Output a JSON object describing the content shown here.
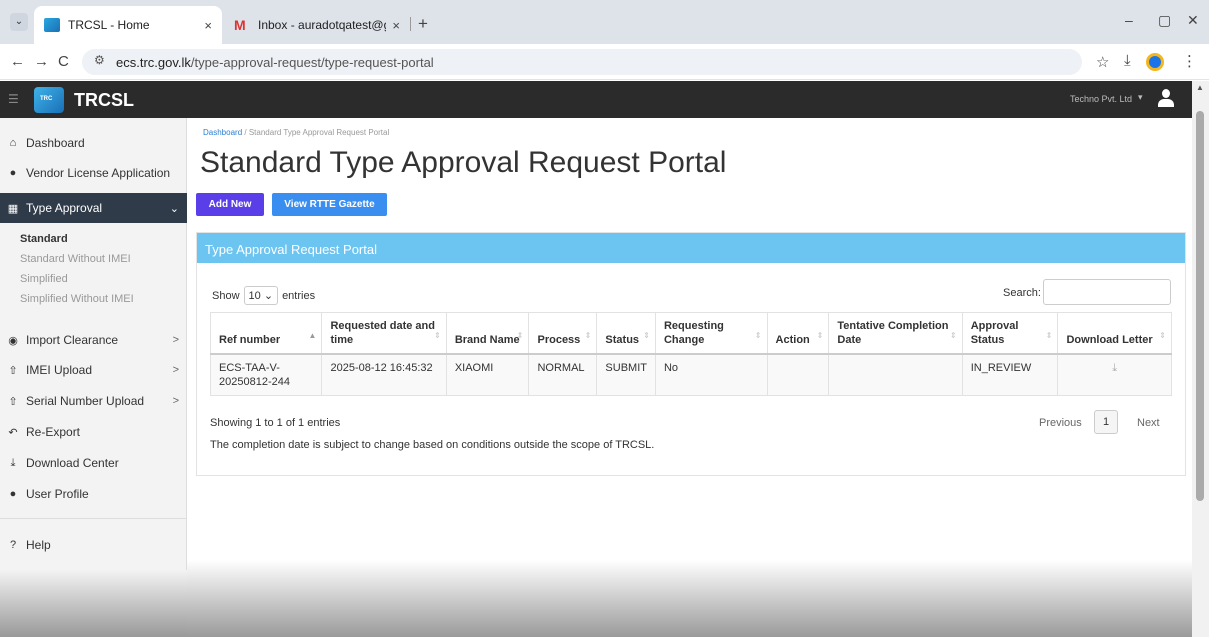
{
  "browser": {
    "tabs": [
      {
        "title": "TRCSL - Home",
        "close": "×"
      },
      {
        "title": "Inbox - auradotqatest@gmail.c",
        "close": "×"
      }
    ],
    "tab_menu": "⌄",
    "new_tab": "+",
    "window": {
      "minimize": "–",
      "restore": "▢",
      "close": "✕"
    },
    "nav": {
      "back": "←",
      "forward": "→",
      "reload": "C"
    },
    "url_host": "ecs.trc.gov.lk",
    "url_path": "/type-approval-request/type-request-portal",
    "star": "☆",
    "download": "⤓",
    "menu": "⋮"
  },
  "header": {
    "brand": "TRCSL",
    "user": "Techno Pvt. Ltd",
    "caret": "▾"
  },
  "sidebar": {
    "items": [
      {
        "label": "Dashboard",
        "icon": "⌂"
      },
      {
        "label": "Vendor License Application",
        "icon": "●"
      },
      {
        "label": "Type Approval",
        "icon": "▦",
        "chevron": "⌄"
      },
      {
        "label": "Import Clearance",
        "icon": "◉",
        "chevron": ">"
      },
      {
        "label": "IMEI Upload",
        "icon": "⇧",
        "chevron": ">"
      },
      {
        "label": "Serial Number Upload",
        "icon": "⇧",
        "chevron": ">"
      },
      {
        "label": "Re-Export",
        "icon": "↶"
      },
      {
        "label": "Download Center",
        "icon": "⤓"
      },
      {
        "label": "User Profile",
        "icon": "●"
      },
      {
        "label": "Help",
        "icon": "?"
      }
    ],
    "subitems": [
      "Standard",
      "Standard Without IMEI",
      "Simplified",
      "Simplified Without IMEI"
    ]
  },
  "main": {
    "breadcrumb_link": "Dashboard",
    "breadcrumb_sep": "/",
    "breadcrumb_current": "Standard Type Approval Request Portal",
    "title": "Standard Type Approval Request Portal",
    "add_new": "Add New",
    "view_rtte": "View RTTE Gazette",
    "panel_title": "Type Approval Request Portal",
    "show_label": "Show",
    "show_value": "10",
    "entries_label": "entries",
    "search_label": "Search:",
    "columns": [
      "Ref number",
      "Requested date and time",
      "Brand Name",
      "Process",
      "Status",
      "Requesting Change",
      "Action",
      "Tentative Completion Date",
      "Approval Status",
      "Download Letter"
    ],
    "rows": [
      [
        "ECS-TAA-V-20250812-244",
        "2025-08-12 16:45:32",
        "XIAOMI",
        "NORMAL",
        "SUBMIT",
        "No",
        "",
        "",
        "IN_REVIEW",
        "⤓"
      ]
    ],
    "info": "Showing 1 to 1 of 1 entries",
    "note": "The completion date is subject to change based on conditions outside the scope of TRCSL.",
    "previous": "Previous",
    "page": "1",
    "next": "Next"
  }
}
